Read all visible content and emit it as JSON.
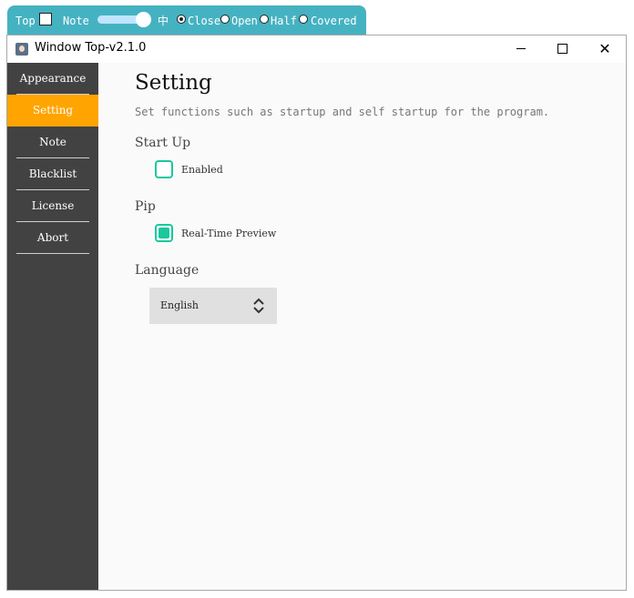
{
  "toolbar": {
    "top_label": "Top",
    "note_label": "Note",
    "lang_label": "中",
    "radio_options": [
      "Close",
      "Open",
      "Half",
      "Covered"
    ],
    "selected": "Close"
  },
  "window": {
    "title": "Window Top-v2.1.0",
    "controls": {
      "minimize": "minimize",
      "maximize": "maximize",
      "close": "close",
      "close_glyph": "✕"
    }
  },
  "sidebar": {
    "items": [
      {
        "label": "Appearance",
        "active": false
      },
      {
        "label": "Setting",
        "active": true
      },
      {
        "label": "Note",
        "active": false
      },
      {
        "label": "Blacklist",
        "active": false
      },
      {
        "label": "License",
        "active": false
      },
      {
        "label": "Abort",
        "active": false
      }
    ]
  },
  "main": {
    "title": "Setting",
    "description": "Set functions such as startup and self startup for the program.",
    "startup": {
      "heading": "Start Up",
      "label": "Enabled",
      "checked": false
    },
    "pip": {
      "heading": "Pip",
      "label": "Real-Time Preview",
      "checked": true
    },
    "language": {
      "heading": "Language",
      "value": "English"
    }
  },
  "colors": {
    "toolbar_bg": "#45b2c2",
    "sidebar_bg": "#424242",
    "accent_orange": "#ffa400",
    "accent_green": "#19c99c"
  },
  "icons": [
    "app-icon",
    "minimize-icon",
    "maximize-icon",
    "close-icon",
    "chevron-updown-icon"
  ]
}
